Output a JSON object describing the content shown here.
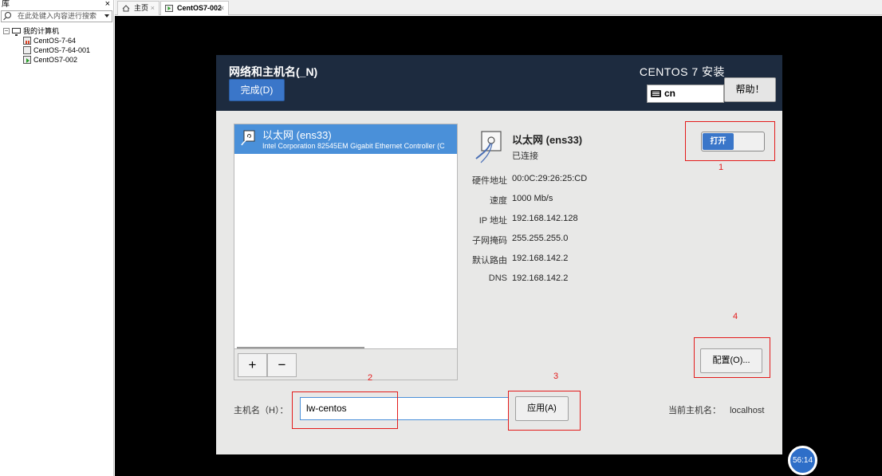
{
  "library": {
    "title": "库",
    "search_placeholder": "在此处键入内容进行搜索",
    "tree_root": "我的计算机",
    "vms": [
      "CentOS-7-64",
      "CentOS-7-64-001",
      "CentOS7-002"
    ]
  },
  "tabs": [
    {
      "label": "主页",
      "active": false
    },
    {
      "label": "CentOS7-002",
      "active": true
    }
  ],
  "installer": {
    "page_title": "网络和主机名(_N)",
    "done_label": "完成(D)",
    "product": "CENTOS 7 安装",
    "keyboard": "cn",
    "help_label": "帮助！",
    "device": {
      "name": "以太网 (ens33)",
      "description": "Intel Corporation 82545EM Gigabit Ethernet Controller (C",
      "status": "已连接"
    },
    "details": [
      {
        "k": "硬件地址",
        "v": "00:0C:29:26:25:CD"
      },
      {
        "k": "速度",
        "v": "1000 Mb/s"
      },
      {
        "k": "IP 地址",
        "v": "192.168.142.128"
      },
      {
        "k": "子网掩码",
        "v": "255.255.255.0"
      },
      {
        "k": "默认路由",
        "v": "192.168.142.2"
      },
      {
        "k": "DNS",
        "v": "192.168.142.2"
      }
    ],
    "switch_label": "打开",
    "add_label": "+",
    "remove_label": "−",
    "config_label": "配置(O)...",
    "hostname_label": "主机名（H）：",
    "hostname_value": "lw-centos",
    "apply_label": "应用(A)",
    "current_host_label": "当前主机名：",
    "current_host_value": "localhost"
  },
  "annotations": [
    "1",
    "2",
    "3",
    "4"
  ],
  "timer": "56:14",
  "colors": {
    "accent": "#3a76c9",
    "annotation": "#e31b1b",
    "header_bg": "#1d2b3f"
  }
}
